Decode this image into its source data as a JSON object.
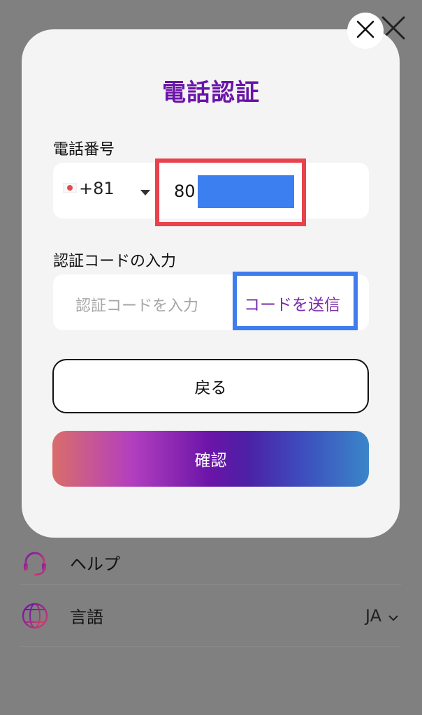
{
  "background": {
    "help_label": "ヘルプ",
    "language_label": "言語",
    "language_value": "JA",
    "icons": [
      "headset-icon",
      "globe-icon",
      "chevron-down-icon",
      "close-icon"
    ]
  },
  "modal": {
    "title": "電話認証",
    "phone_label": "電話番号",
    "country_code": "+81",
    "phone_value": "80",
    "code_label": "認証コードの入力",
    "code_placeholder": "認証コードを入力",
    "send_code": "コードを送信",
    "back_button": "戻る",
    "confirm_button": "確認"
  },
  "colors": {
    "accent": "#6a14a8",
    "phone_highlight": "#e8424d",
    "send_highlight": "#3f7ded",
    "redaction": "#3b7ff0"
  }
}
